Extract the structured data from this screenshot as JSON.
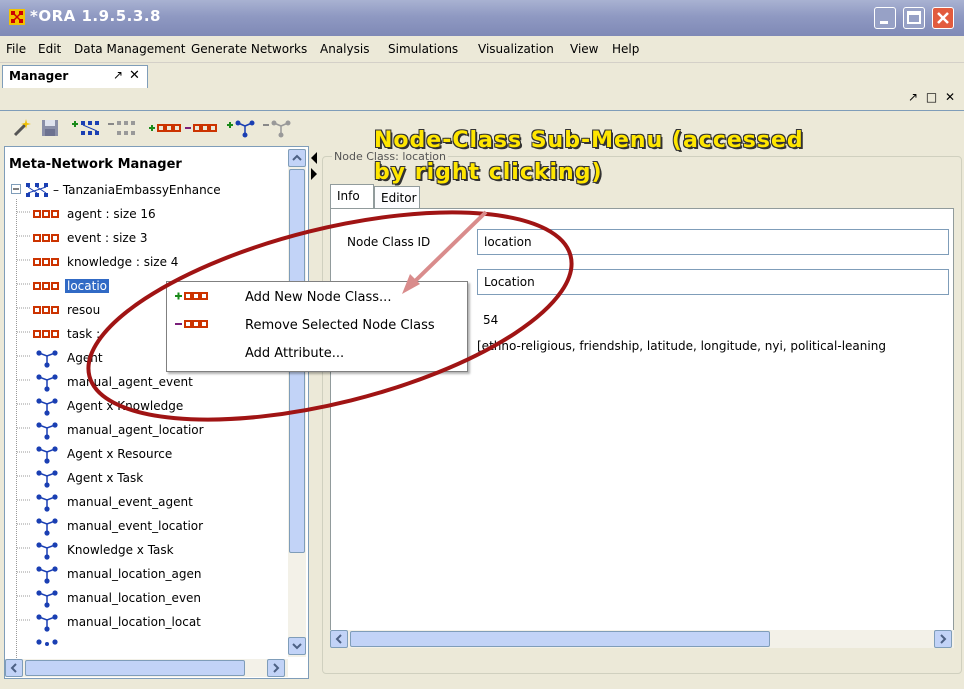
{
  "window": {
    "title": "*ORA 1.9.5.3.8",
    "icon": "ora-app-icon",
    "controls": [
      "minimize",
      "maximize",
      "close"
    ]
  },
  "menubar": {
    "items": [
      "File",
      "Edit",
      "Data Management",
      "Generate Networks",
      "Analysis",
      "Simulations",
      "Visualization",
      "View",
      "Help"
    ]
  },
  "manager_tab": {
    "label": "Manager",
    "pin_glyph": "↗",
    "close_glyph": "✕",
    "right_controls": "↗ □ ✕"
  },
  "toolbar": {
    "buttons": [
      "wand-icon",
      "save-icon",
      "add-meta-network-icon",
      "remove-meta-network-icon",
      "add-node-class-icon",
      "remove-node-class-icon",
      "add-network-icon",
      "remove-network-icon"
    ]
  },
  "tree": {
    "title": "Meta-Network Manager",
    "root": "TanzaniaEmbassyEnhance",
    "node_classes": [
      {
        "label": "agent : size 16"
      },
      {
        "label": "event : size 3"
      },
      {
        "label": "knowledge : size 4"
      },
      {
        "label": "locatio"
      },
      {
        "label": "resou"
      },
      {
        "label": "task :"
      }
    ],
    "networks": [
      {
        "label": "Agent"
      },
      {
        "label": "manual_agent_event"
      },
      {
        "label": "Agent x Knowledge"
      },
      {
        "label": "manual_agent_locatior"
      },
      {
        "label": "Agent x Resource"
      },
      {
        "label": "Agent x Task"
      },
      {
        "label": "manual_event_agent"
      },
      {
        "label": "manual_event_locatior"
      },
      {
        "label": "Knowledge x Task"
      },
      {
        "label": "manual_location_agen"
      },
      {
        "label": "manual_location_even"
      },
      {
        "label": "manual_location_locat"
      }
    ]
  },
  "detail": {
    "group_title": "Node Class: location",
    "tabs": [
      "Info",
      "Editor"
    ],
    "fields": {
      "node_class_id_label": "Node Class ID",
      "node_class_id": "location",
      "type_value": "Location",
      "size_value": "54",
      "attributes_value": "[ethno-religious, friendship, latitude, longitude, nyi, political-leaning"
    }
  },
  "context_menu": {
    "items": [
      {
        "label": "Add New Node Class...",
        "icon": "add-node-class-icon"
      },
      {
        "label": "Remove Selected Node Class",
        "icon": "remove-node-class-icon"
      },
      {
        "label": "Add Attribute...",
        "icon": ""
      }
    ]
  },
  "annotation": {
    "line1": "Node-Class Sub-Menu (accessed",
    "line2": "by right clicking)",
    "color": "#ffe600"
  },
  "colors": {
    "title_bar": "#8f99c2",
    "selection": "#316ac5",
    "node_icon": "#cc3300",
    "network_icon": "#1a3fb3",
    "oval": "#a01414",
    "arrow": "#d98c8c"
  }
}
